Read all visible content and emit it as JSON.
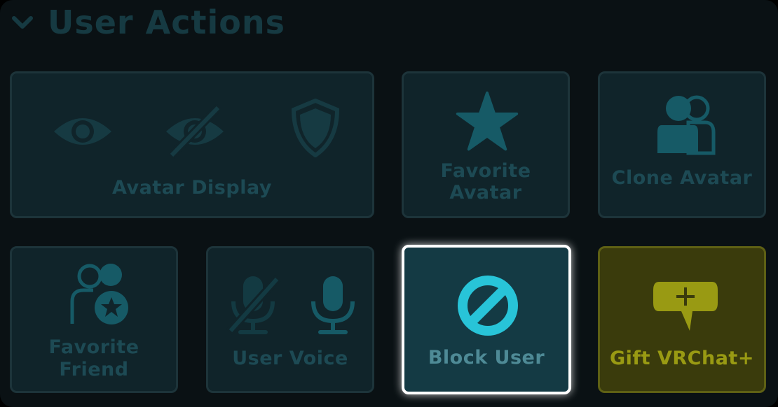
{
  "header": {
    "title": "User Actions",
    "chevron_icon": "chevron-down-icon"
  },
  "tiles": {
    "avatar_display": {
      "label": "Avatar Display",
      "icons": [
        "eye-icon",
        "eye-off-icon",
        "shield-icon"
      ]
    },
    "favorite_avatar": {
      "label_line1": "Favorite",
      "label_line2": "Avatar",
      "icon": "star-icon"
    },
    "clone_avatar": {
      "label": "Clone Avatar",
      "icon": "clone-users-icon"
    },
    "favorite_friend": {
      "label_line1": "Favorite",
      "label_line2": "Friend",
      "icon": "friend-star-icon"
    },
    "user_voice": {
      "label": "User Voice",
      "icons": [
        "mic-off-icon",
        "mic-icon"
      ]
    },
    "block_user": {
      "label": "Block User",
      "icon": "block-icon",
      "state": "focused"
    },
    "gift_vrchat": {
      "label": "Gift VRChat+",
      "icon": "speech-plus-icon"
    }
  },
  "colors": {
    "background": "#0a1114",
    "tile_bg": "#10242a",
    "tile_border": "#1d343a",
    "dim_text": "#1d4a54",
    "accent_cyan": "#28c4d8",
    "gift_bg": "#3a3b0c",
    "gift_text": "#999a13",
    "focus_outline": "#ffffff"
  }
}
